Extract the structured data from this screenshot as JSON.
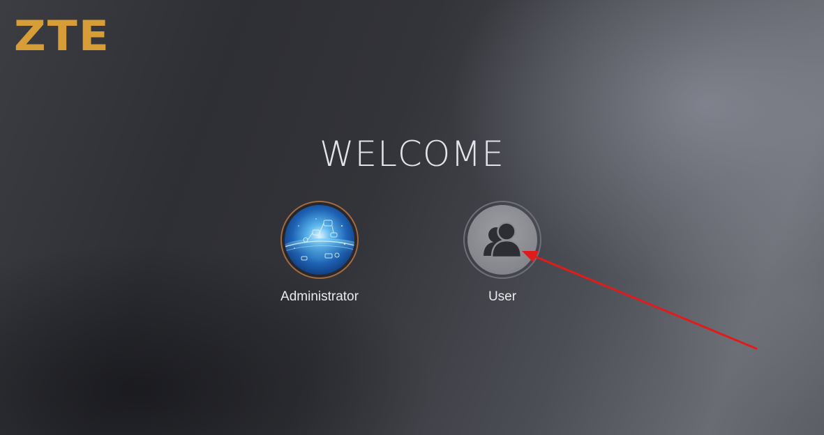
{
  "brand": {
    "logo_text": "ZTE",
    "logo_color": "#d79d37"
  },
  "welcome": {
    "title": "WELCOME"
  },
  "roles": [
    {
      "label": "Administrator",
      "icon": "globe-network-icon"
    },
    {
      "label": "User",
      "icon": "users-icon"
    }
  ],
  "annotation": {
    "type": "arrow",
    "color": "#e11b1b",
    "points_to": "User"
  },
  "colors": {
    "label_text": "#e9eaee",
    "admin_ring": "#a36a3e",
    "user_ring": "#6e7079"
  }
}
